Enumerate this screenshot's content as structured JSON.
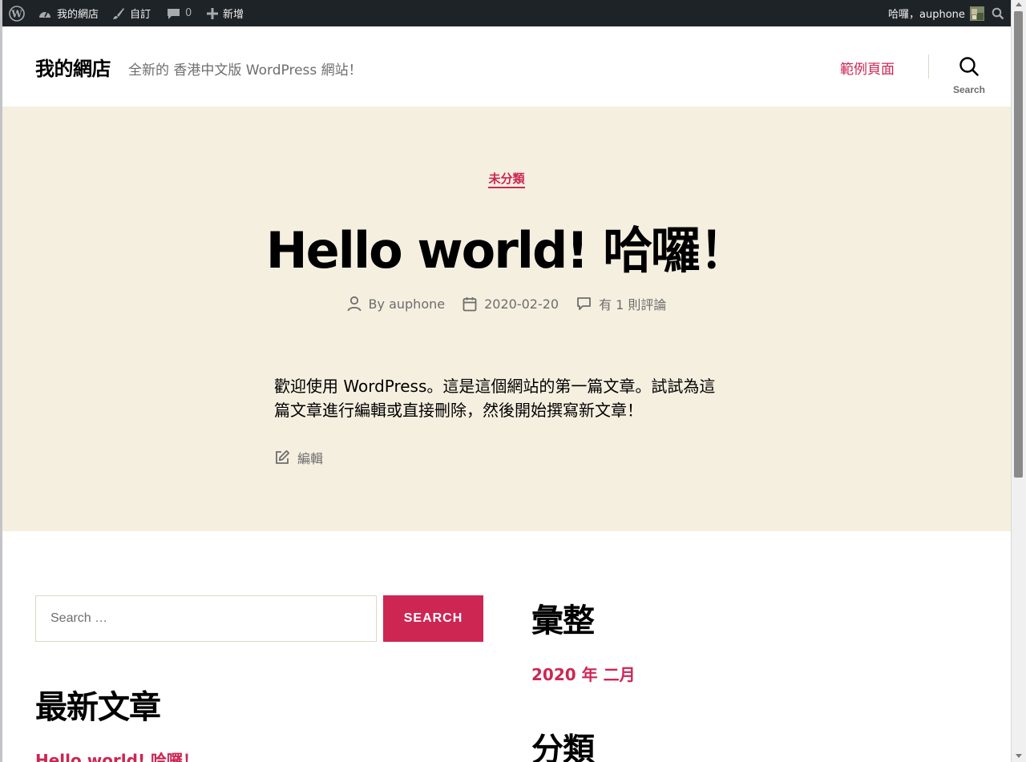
{
  "admin_bar": {
    "site_name": "我的網店",
    "customize": "自訂",
    "comments_count": "0",
    "new": "新增",
    "greeting": "哈囉，auphone"
  },
  "header": {
    "site_title": "我的網店",
    "site_description": "全新的 香港中文版 WordPress 網站！",
    "nav_link": "範例頁面",
    "search_label": "Search"
  },
  "post": {
    "category": "未分類",
    "title": "Hello world! 哈囉！",
    "author": "By auphone",
    "date": "2020-02-20",
    "comments": "有 1 則評論",
    "content_line1": "歡迎使用 WordPress。這是這個網站的第一篇文章。試試為這",
    "content_line2": "篇文章進行編輯或直接刪除，然後開始撰寫新文章！",
    "edit": "編輯"
  },
  "widgets": {
    "search_placeholder": "Search …",
    "search_button": "SEARCH",
    "recent_posts_title": "最新文章",
    "recent_post_1": "Hello world! 哈囉！",
    "archives_title": "彙整",
    "archive_1": "2020 年 二月",
    "categories_title": "分類"
  },
  "colors": {
    "accent": "#cd2653",
    "hero_bg": "#f5efe0",
    "admin_bar_bg": "#1d2327"
  }
}
